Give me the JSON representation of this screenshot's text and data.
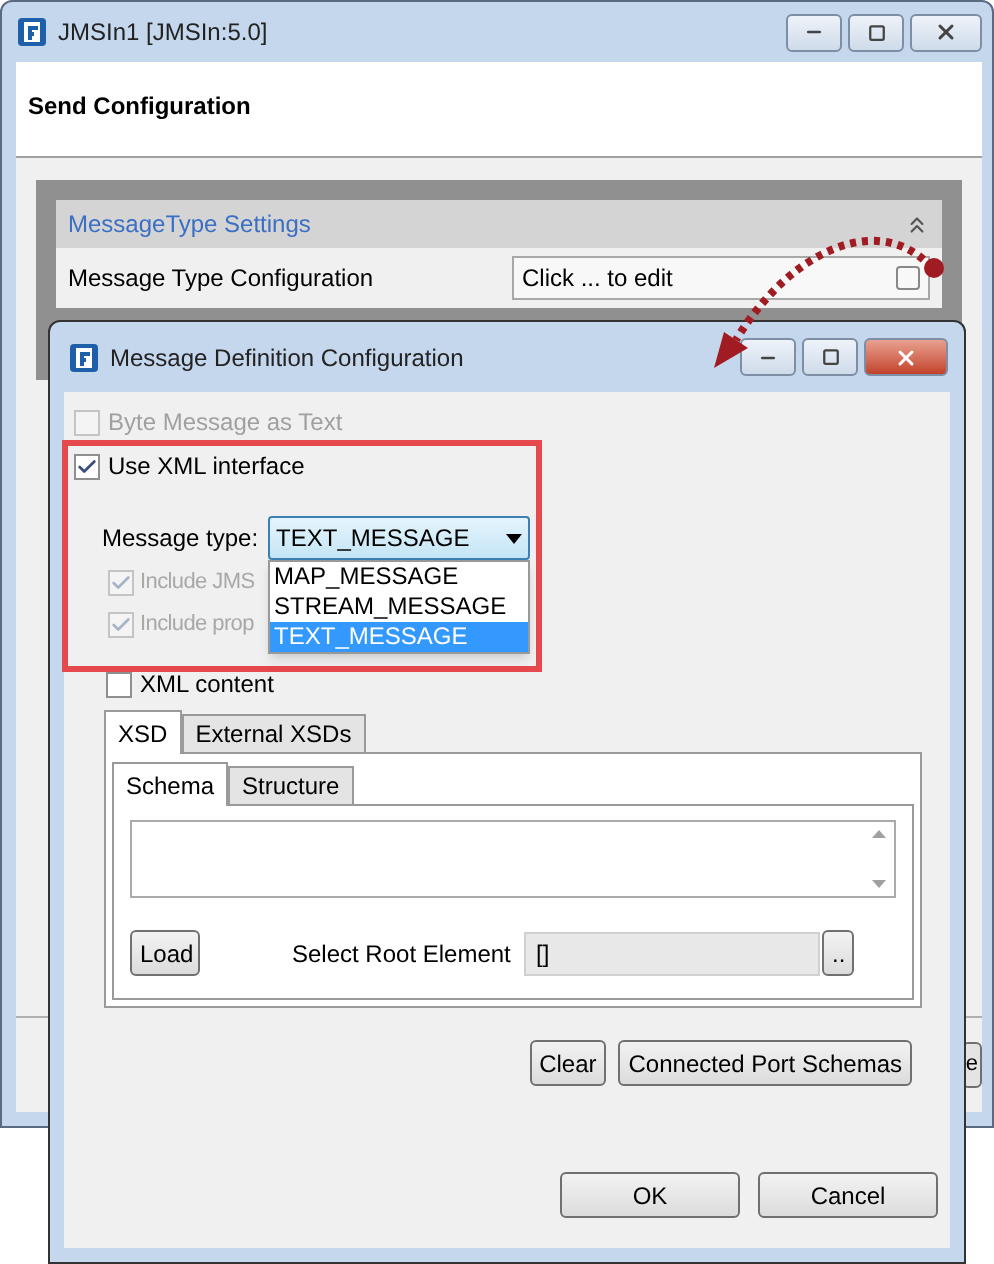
{
  "background_window": {
    "title": "JMSIn1 [JMSIn:5.0]",
    "heading": "Send Configuration",
    "section": {
      "title": "MessageType Settings",
      "expanded": true,
      "rows": [
        {
          "label": "Message Type Configuration",
          "value": "Click ... to edit"
        }
      ]
    },
    "button_text": "e"
  },
  "dialog": {
    "title": "Message Definition Configuration",
    "options": [
      {
        "label": "Byte Message as Text",
        "checked": false,
        "disabled": true
      },
      {
        "label": "Use XML interface",
        "checked": true,
        "disabled": false
      }
    ],
    "message_type": {
      "label": "Message type:",
      "value": "TEXT_MESSAGE",
      "expanded": true,
      "options": [
        {
          "label": "MAP_MESSAGE",
          "selected": false
        },
        {
          "label": "STREAM_MESSAGE",
          "selected": false
        },
        {
          "label": "TEXT_MESSAGE",
          "selected": true
        }
      ]
    },
    "sub_options": [
      {
        "label": "Include JMS",
        "checked": true,
        "disabled": true
      },
      {
        "label": "Include prop",
        "checked": true,
        "disabled": true
      }
    ],
    "xml_content": {
      "label": "XML content",
      "checked": false
    },
    "tabs": [
      {
        "label": "XSD",
        "selected": true
      },
      {
        "label": "External XSDs",
        "selected": false
      }
    ],
    "inner_tabs": [
      {
        "label": "Schema",
        "selected": true
      },
      {
        "label": "Structure",
        "selected": false
      }
    ],
    "load_button": "Load",
    "root_element": {
      "label": "Select Root Element",
      "value": "[]",
      "browse": ".."
    },
    "actions": [
      "Clear",
      "Connected Port Schemas"
    ],
    "buttons": [
      "OK",
      "Cancel"
    ]
  }
}
